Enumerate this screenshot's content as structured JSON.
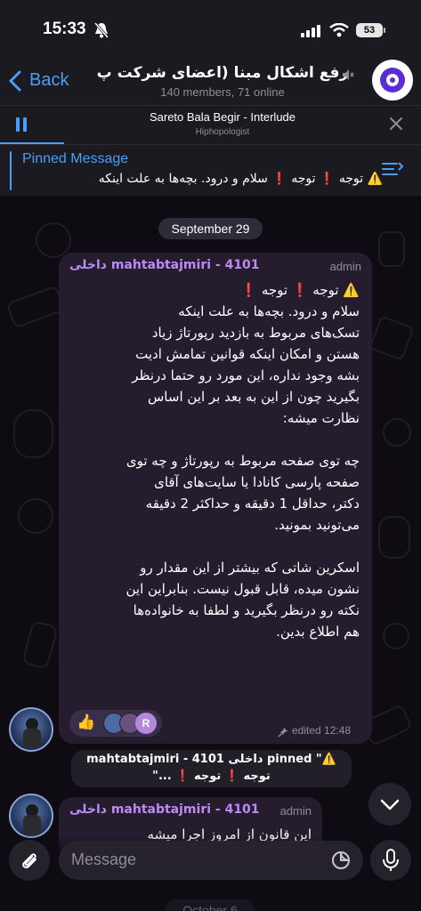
{
  "status_bar": {
    "time": "15:33",
    "battery": "53"
  },
  "header": {
    "back_label": "Back",
    "title": "رفع اشکال مبنا (اعضای شرکت پ",
    "subtitle": "140 members, 71 online"
  },
  "music_bar": {
    "title": "Sareto Bala Begir - Interlude",
    "artist": "Hiphopologist"
  },
  "pinned": {
    "label": "Pinned Message",
    "text": "⚠️ توجه ❗ توجه ❗ سلام و درود. بچه‌ها به علت اینکه"
  },
  "date_pills": {
    "first": "September 29",
    "second": "October 6"
  },
  "message1": {
    "sender": "mahtabtajmiri - 4101 داخلی",
    "role": "admin",
    "body": "⚠️ توجه ❗ توجه ❗\nسلام و درود. بچه‌ها به علت اینکه\nتسک‌های مربوط به بازدید رپورتاژ زیاد\nهستن و امکان اینکه قوانین تمامش ادیت\nبشه وجود نداره، این مورد رو حتما درنظر\nبگیرید چون از این به بعد بر این اساس\nنظارت میشه:\n\nچه توی صفحه مربوط به رپورتاژ و چه توی\nصفحه پارسی کانادا یا سایت‌های آقای\nدکتر، حداقل 1 دقیقه و حداکثر 2 دقیقه\nمی‌تونید بمونید.\n\nاسکرین شاتی که بیشتر از این مقدار رو\nنشون میده، قابل قبول نیست. بنابراین این\nنکته رو درنظر بگیرید و لطفا به خانواده‌ها\nهم اطلاع بدین.",
    "reaction_emoji": "👍",
    "reaction_letter": "R",
    "meta": "edited 12:48"
  },
  "service_message": {
    "line1": "mahtabtajmiri - 4101 داخلی pinned \"⚠️",
    "line2": "توجه ❗ توجه ❗ ...\""
  },
  "message2": {
    "sender": "mahtabtajmiri - 4101 داخلی",
    "role": "admin",
    "body": "این قانون از امروز اجرا میشه"
  },
  "input": {
    "placeholder": "Message"
  },
  "colors": {
    "accent": "#4a9ef8",
    "bubble": "#251d2e",
    "sender": "#b98cf5"
  }
}
